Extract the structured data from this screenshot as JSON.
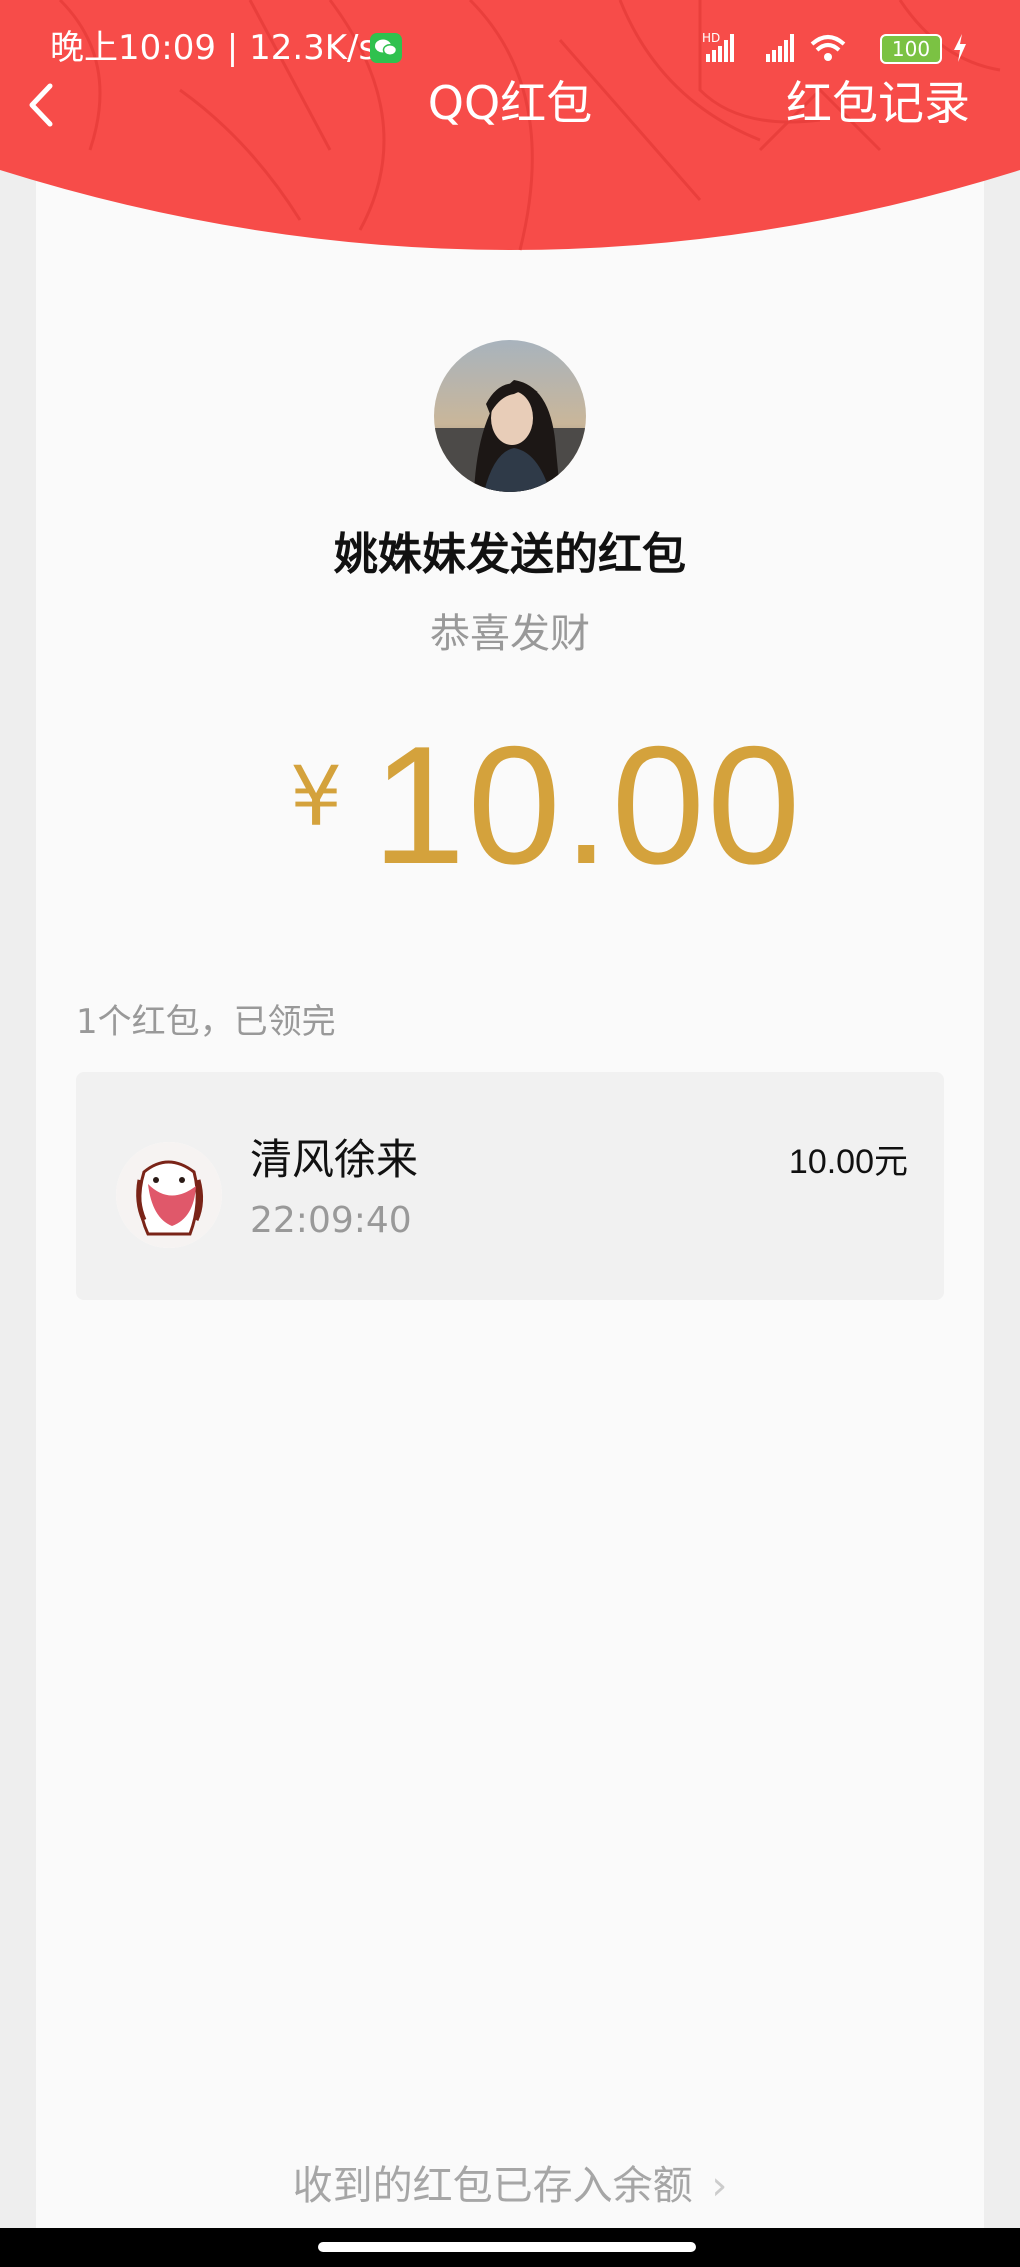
{
  "status_bar": {
    "time": "晚上10:09",
    "network_speed": "12.3K/s",
    "battery": "100",
    "signal_label": "HD"
  },
  "header": {
    "back_icon": "chevron-left-icon",
    "title": "QQ红包",
    "records_link": "红包记录",
    "background_color": "#f74c49"
  },
  "sender": {
    "title": "姚姝妹发送的红包",
    "blessing": "恭喜发财"
  },
  "amount": {
    "currency": "¥",
    "value": "10.00",
    "color": "#d4a23c"
  },
  "summary": "1个红包，已领完",
  "receivers": [
    {
      "name": "清风徐来",
      "time": "22:09:40",
      "amount": "10.00",
      "unit": "元"
    }
  ],
  "footer": {
    "balance_text": "收到的红包已存入余额",
    "chevron": "›"
  }
}
